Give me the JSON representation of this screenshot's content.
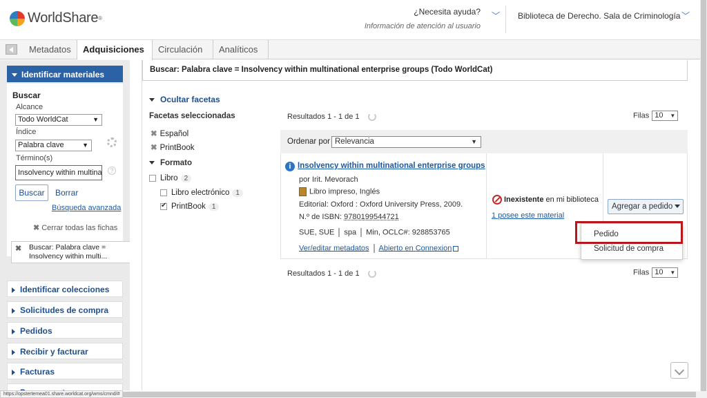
{
  "header": {
    "brand": "WorldShare",
    "brand_tm": "®",
    "help_question": "¿Necesita ayuda?",
    "help_info": "Información de atención al usuario",
    "branch_name": "Biblioteca de Derecho. Sala de Criminología"
  },
  "nav": {
    "tabs": [
      "Metadatos",
      "Adquisiciones",
      "Circulación",
      "Analíticos"
    ],
    "active_tab": "Adquisiciones"
  },
  "sidebar": {
    "identify_materials": "Identificar materiales",
    "search_title": "Buscar",
    "scope_label": "Alcance",
    "scope_value": "Todo WorldCat",
    "index_label": "Índice",
    "index_value": "Palabra clave",
    "terms_label": "Término(s)",
    "terms_value": "Insolvency within multina",
    "search_button": "Buscar",
    "clear_link": "Borrar",
    "advanced_link": "Búsqueda avanzada",
    "close_all": "Cerrar todas las fichas",
    "crumb": "Buscar: Palabra clave = Insolvency within multi...",
    "sections": [
      "Identificar colecciones",
      "Solicitudes de compra",
      "Pedidos",
      "Recibir y facturar",
      "Facturas",
      "Presupuestos"
    ]
  },
  "main": {
    "query": "Buscar: Palabra clave = Insolvency within multinational enterprise groups (Todo WorldCat)",
    "hide_facets": "Ocultar facetas",
    "selected_facets_title": "Facetas seleccionadas",
    "selected_facets": [
      "Español",
      "PrintBook"
    ],
    "format_title": "Formato",
    "format_items": [
      {
        "label": "Libro",
        "count": "2",
        "checked": false
      },
      {
        "label": "Libro electrónico",
        "count": "1",
        "checked": false
      },
      {
        "label": "PrintBook",
        "count": "1",
        "checked": true
      }
    ],
    "results_count": "Resultados 1 - 1 de 1",
    "rows_label": "Filas",
    "rows_value": "10",
    "sort_label": "Ordenar por",
    "sort_value": "Relevancia"
  },
  "result": {
    "title": "Insolvency within multinational enterprise groups",
    "author": "por Irit. Mevorach",
    "format": "Libro impreso, Inglés",
    "publisher": "Editorial: Oxford : Oxford University Press, 2009.",
    "isbn_label": "N.º de ISBN:",
    "isbn": "9780199544721",
    "codes": [
      "SUE, SUE",
      "spa",
      "Min, OCLC#: 928853765"
    ],
    "edit_link": "Ver/editar metadatos",
    "connexion_link": "Abierto en Connexion",
    "holding_status_bold": "Inexistente",
    "holding_status_rest": " en mi biblioteca",
    "holding_link": "1 posee este material",
    "order_button": "Agregar a pedido",
    "menu": [
      "Pedido",
      "Solicitud de compra"
    ]
  },
  "statusbar_url": "https://opstertemea01.share.worldcat.org/wms/cmnd/#",
  "colors": {
    "accent": "#2a62a5",
    "highlight": "#b5171d",
    "link": "#1a5aa6"
  }
}
